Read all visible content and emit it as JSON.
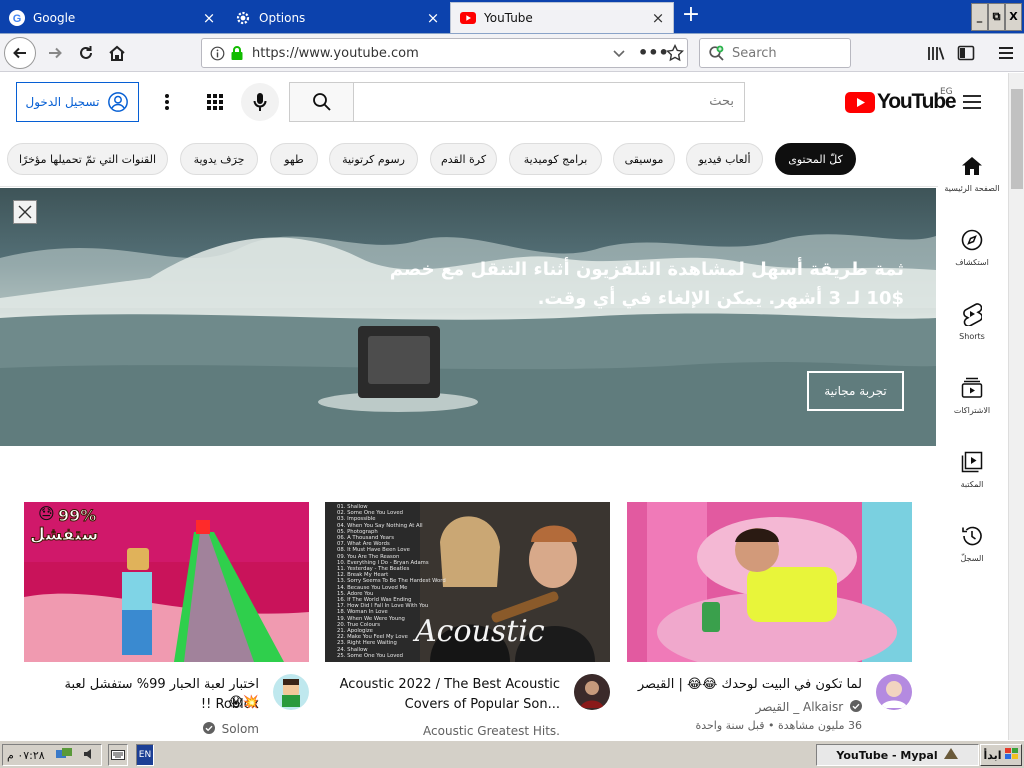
{
  "tabs": [
    {
      "title": "Google",
      "icon": "google-icon",
      "close": "×"
    },
    {
      "title": "Options",
      "icon": "gear-icon",
      "close": "×"
    },
    {
      "title": "YouTube",
      "icon": "youtube-icon",
      "close": "×",
      "active": true
    }
  ],
  "new_tab_label": "+",
  "window_buttons": {
    "minimize": "_",
    "restore": "⧉",
    "close": "X"
  },
  "nav": {
    "url": "https://www.youtube.com",
    "search_placeholder": "Search"
  },
  "youtube": {
    "signin_label": "تسجيل الدخول",
    "search_placeholder": "بحث",
    "logo_text": "YouTube",
    "country_code": "EG",
    "chips": [
      {
        "label": "كلّ المحتوى",
        "active": true
      },
      {
        "label": "ألعاب فيديو"
      },
      {
        "label": "موسيقى"
      },
      {
        "label": "برامج كوميدية"
      },
      {
        "label": "كرة القدم"
      },
      {
        "label": "رسوم كرتونية"
      },
      {
        "label": "طهو"
      },
      {
        "label": "حِرَف يدوية"
      },
      {
        "label": "القنوات التي تمّ تحميلها مؤخرًا"
      }
    ],
    "rail": [
      {
        "label": "الصفحة الرئيسية",
        "icon": "home-icon"
      },
      {
        "label": "استكشاف",
        "icon": "compass-icon"
      },
      {
        "label": "Shorts",
        "icon": "shorts-icon"
      },
      {
        "label": "الاشتراكات",
        "icon": "subscriptions-icon"
      },
      {
        "label": "المكتبة",
        "icon": "library-icon"
      },
      {
        "label": "السجلّ",
        "icon": "history-icon"
      }
    ],
    "banner": {
      "line1": "ثمة طريقة أسهل لمشاهدة التلفزيون أثناء التنقل مع خصم",
      "line2": "10$ لـ 3 أشهر. يمكن الإلغاء في أي وقت.",
      "cta": "تجربة مجانية"
    },
    "videos": [
      {
        "title": "لما تكون في البيت لوحدك 😂😂 | القيصر",
        "channel": "القيصر _ Alkaisr",
        "verified": true,
        "views": "36 مليون مشاهدة",
        "age": "قبل سنة واحدة"
      },
      {
        "title": "Acoustic 2022 / The Best Acoustic Covers of Popular Son...",
        "channel": "Acoustic Greatest Hits.",
        "verified": false,
        "thumb_word": "Acoustic",
        "playlist": [
          "01. Shallow",
          "02. Some One You Loved",
          "03. Impossible",
          "04. When You Say Nothing At All",
          "05. Photograph",
          "06. A Thousand Years",
          "07. What Are Words",
          "08. It Must Have Been Love",
          "09. You Are The Reason",
          "10. Everything I Do - Bryan Adams",
          "11. Yesterday - The Beatles",
          "12. Break My Heart",
          "13. Sorry Seems To Be The Hardest Word",
          "14. Because You Loved Me",
          "15. Adore You",
          "16. If The World Was Ending",
          "17. How Did I Fall In Love With You",
          "18. Woman In Love",
          "19. When We Were Young",
          "20. True Colours",
          "21. Apologize",
          "22. Make You Feel My Love",
          "23. Right Here Waiting",
          "24. Shallow",
          "25. Some One You Loved"
        ]
      },
      {
        "title": "اختبار لعبة الحبار 99% ستفشل لعبة Roblox !!",
        "channel": "Solom",
        "verified": true,
        "thumb_badge_pct": "99%",
        "thumb_badge_text": "ستفشل"
      }
    ]
  },
  "taskbar": {
    "time": "٠٧:٢٨ م",
    "lang": "EN",
    "task_title": "YouTube - Mypal",
    "start_label": "ابدأ"
  }
}
